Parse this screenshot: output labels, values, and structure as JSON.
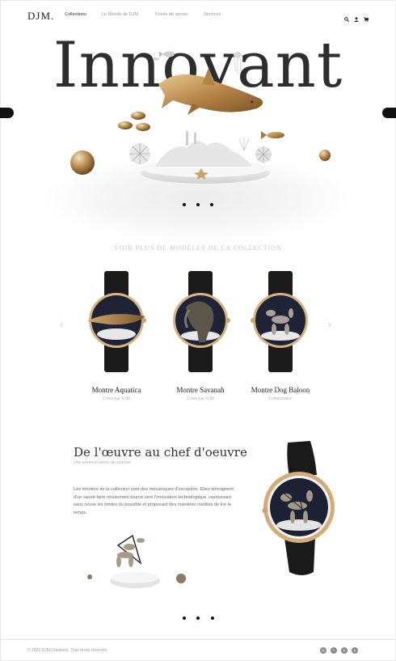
{
  "header": {
    "logo": "DJM.",
    "nav": [
      {
        "label": "Collections",
        "active": true
      },
      {
        "label": "Le Monde de DJM",
        "active": false
      },
      {
        "label": "Points de ventes",
        "active": false
      },
      {
        "label": "Services",
        "active": false
      }
    ],
    "icons": [
      "search-icon",
      "user-icon",
      "cart-icon"
    ]
  },
  "hero": {
    "title": "Innovant",
    "slides_total": 3,
    "active_slide": 1
  },
  "collection": {
    "heading": "VOIR PLUS DE MODÈLES DE LA COLLECTION",
    "products": [
      {
        "name": "Montre Aquatica",
        "subtitle": "Créée par DJM"
      },
      {
        "name": "Montre Savanah",
        "subtitle": "Créée par DJM"
      },
      {
        "name": "Montre Dog Baloon",
        "subtitle": "Collaboration"
      }
    ],
    "prev_arrow": "‹",
    "next_arrow": "›"
  },
  "masterpiece": {
    "title": "De l'œuvre au chef d'oeuvre",
    "subtitle": "Une aventure pleine de surprise",
    "body": "Les montres de la collection sont des mécaniques d'exception. Elles témoignent d'un savoir-faire résolument tourné vers l'innovation technologique, repoussant sans cesse les limites du possible et proposant des manières inédites de lire le temps.",
    "slides_total": 3,
    "active_slide": 2
  },
  "footer": {
    "copyright": "© 2022 DJM Créations. Tous droits réservés.",
    "socials": [
      "instagram-icon",
      "facebook-icon",
      "youtube-icon",
      "pinterest-icon"
    ]
  },
  "colors": {
    "text": "#2e2e2e",
    "gold": "#c9a36a",
    "strap": "#1a1a1a",
    "dial": "#1b2236"
  }
}
